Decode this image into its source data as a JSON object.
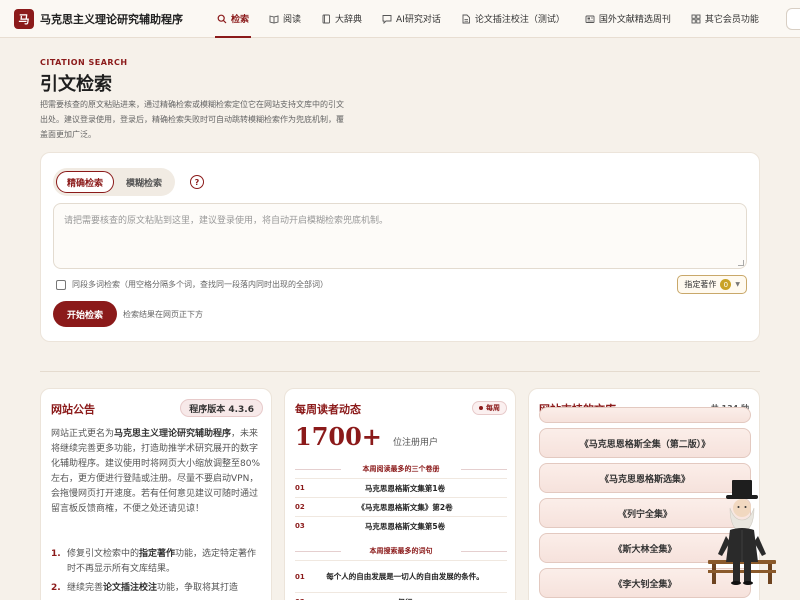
{
  "brand": {
    "logo": "马",
    "name": "马克思主义理论研究辅助程序"
  },
  "nav": [
    {
      "label": "检索",
      "icon": "search-icon",
      "active": true
    },
    {
      "label": "阅读",
      "icon": "book-open-icon",
      "active": false
    },
    {
      "label": "大辞典",
      "icon": "book-icon",
      "active": false
    },
    {
      "label": "AI研究对话",
      "icon": "chat-icon",
      "active": false
    },
    {
      "label": "论文插注校注（测试）",
      "icon": "document-icon",
      "active": false
    },
    {
      "label": "国外文献精选周刊",
      "icon": "newspaper-icon",
      "active": false
    },
    {
      "label": "其它会员功能",
      "icon": "grid-icon",
      "active": false
    }
  ],
  "hero": {
    "eyebrow": "CITATION SEARCH",
    "title": "引文检索",
    "description": "把需要核查的原文粘贴进来，通过精确检索或模糊检索定位它在网站支持文库中的引文出处。建议登录使用，登录后，精确检索失败时可自动跳转模糊检索作为兜底机制，覆盖面更加广泛。"
  },
  "search": {
    "mode_exact": "精确检索",
    "mode_fuzzy": "模糊检索",
    "help": "?",
    "placeholder": "请把需要核查的原文粘贴到这里，建议登录使用，将自动开启模糊检索兜底机制。",
    "multi_label": "同段多词检索（用空格分隔多个词，查找同一段落内同时出现的全部词）",
    "author_label": "指定著作",
    "author_count": "0",
    "submit": "开始检索",
    "hint": "检索结果在网页正下方"
  },
  "notice": {
    "title": "网站公告",
    "version": "程序版本 4.3.6",
    "body_pre": "网站正式更名为",
    "body_name": "马克思主义理论研究辅助程序",
    "body_post": "，未来将继续完善更多功能，打造助推学术研究展开的数字化辅助程序。建议使用时将网页大小缩放调整至80%左右，更方便进行登陆或注册。尽量不要启动VPN，会拖慢网页打开速度。若有任何意见建议可随时通过留言板反馈商榷，不便之处还请见谅！",
    "items": [
      {
        "num": "1.",
        "pre": "修复引文检索中的",
        "bold": "指定著作",
        "post": "功能，选定特定著作时不再显示所有文库结果。"
      },
      {
        "num": "2.",
        "pre": "继续完善",
        "bold": "论文插注校注",
        "post": "功能，争取将其打造"
      }
    ]
  },
  "weekly": {
    "title": "每周读者动态",
    "badge": "每周",
    "users": "1700+",
    "users_unit": "位注册用户",
    "top_volumes_label": "本周阅读最多的三个卷册",
    "top_volumes": [
      {
        "rank": "01",
        "text": "马克思恩格斯文集第1卷"
      },
      {
        "rank": "02",
        "text": "《马克思恩格斯文集》第2卷"
      },
      {
        "rank": "03",
        "text": "马克思恩格斯文集第5卷"
      }
    ],
    "top_terms_label": "本周搜索最多的词句",
    "top_terms": [
      {
        "rank": "01",
        "text": "每个人的自由发展是一切人的自由发展的条件。"
      },
      {
        "rank": "02",
        "text": "但行"
      }
    ]
  },
  "libraries": {
    "title": "网站支持的文库",
    "count": "共 134 种",
    "items": [
      "《马克思恩格斯全集（第二版）》",
      "《马克思恩格斯选集》",
      "《列宁全集》",
      "《斯大林全集》",
      "《李大钊全集》"
    ]
  },
  "colors": {
    "accent": "#8b1a1a",
    "background": "#f6f1ea",
    "gold": "#c9a227"
  }
}
